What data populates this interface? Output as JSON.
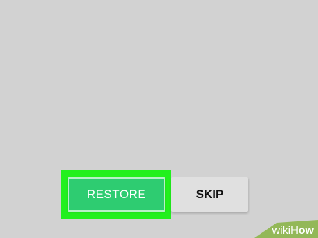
{
  "dialog": {
    "restore_label": "RESTORE",
    "skip_label": "SKIP"
  },
  "watermark": {
    "text": "wikiHow"
  },
  "colors": {
    "background": "#d2d2d2",
    "highlight": "#22f01e",
    "restore": "#2ecc71",
    "skip": "#e0e0e0"
  }
}
